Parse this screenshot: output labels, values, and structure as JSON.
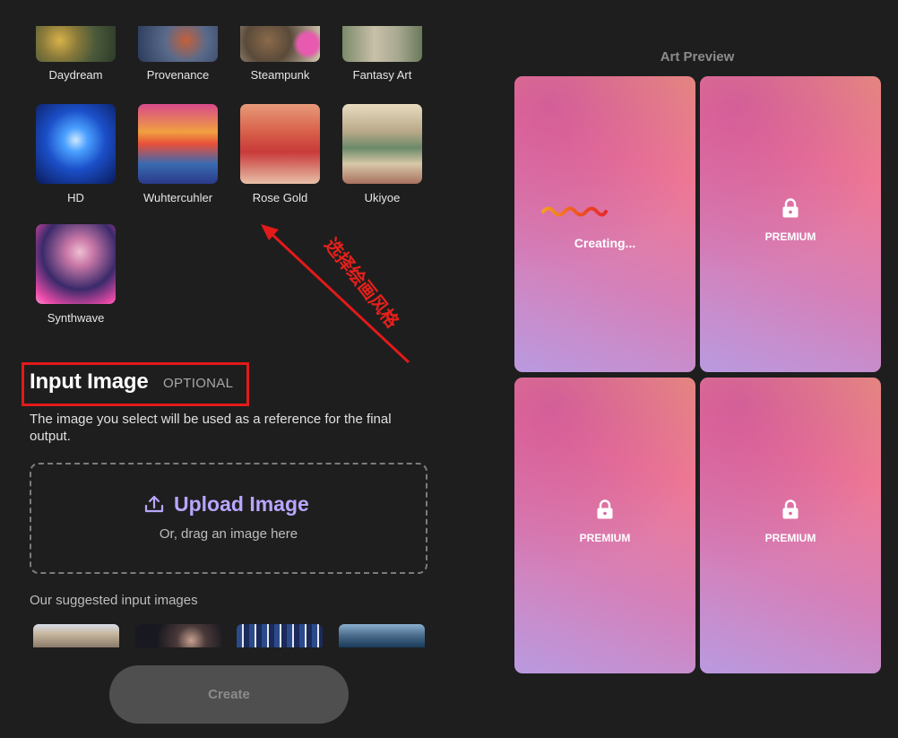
{
  "styles": [
    {
      "label": "Daydream"
    },
    {
      "label": "Provenance"
    },
    {
      "label": "Steampunk"
    },
    {
      "label": "Fantasy Art"
    },
    {
      "label": "HD"
    },
    {
      "label": "Wuhtercuhler"
    },
    {
      "label": "Rose Gold"
    },
    {
      "label": "Ukiyoe"
    },
    {
      "label": "Synthwave"
    }
  ],
  "annotation": {
    "text": "选择绘画风格",
    "color": "#e21a1a"
  },
  "input_image": {
    "title": "Input Image",
    "optional": "OPTIONAL",
    "description": "The image you select will be used as a reference for the final output.",
    "upload_label": "Upload Image",
    "upload_sub": "Or, drag an image here",
    "suggested_title": "Our suggested input images"
  },
  "create_label": "Create",
  "preview": {
    "title": "Art Preview",
    "cards": [
      {
        "state": "Creating..."
      },
      {
        "state": "PREMIUM"
      },
      {
        "state": "PREMIUM"
      },
      {
        "state": "PREMIUM"
      }
    ]
  },
  "colors": {
    "accent": "#b9a6ff",
    "background": "#1e1e1e",
    "button": "#4f4f4f"
  },
  "icons": {
    "upload": "upload-icon",
    "lock": "lock-icon",
    "loading": "wave-loader-icon"
  }
}
